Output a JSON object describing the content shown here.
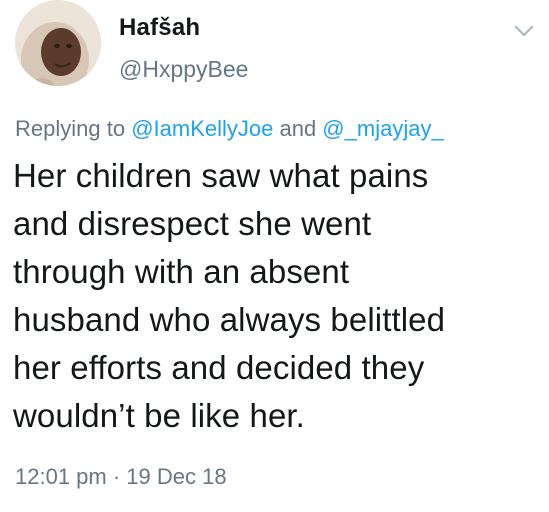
{
  "user": {
    "display_name": "Hafšah",
    "handle": "@HxppyBee",
    "avatar_icon": "profile-photo"
  },
  "reply": {
    "prefix": "Replying to ",
    "mention_1": "@IamKellyJoe",
    "joiner": " and ",
    "mention_2": "@_mjayjay_"
  },
  "tweet": {
    "text": "Her children saw what pains\nand disrespect she went\nthrough with an absent\nhusband who always belittled\nher efforts and decided they\nwouldn’t be like her.",
    "timestamp": "12:01 pm · 19 Dec 18"
  },
  "icons": {
    "menu": "chevron-down-icon"
  },
  "colors": {
    "text_primary": "#14171a",
    "text_secondary": "#657786",
    "link": "#1da1f2",
    "icon": "#aab8c2"
  }
}
